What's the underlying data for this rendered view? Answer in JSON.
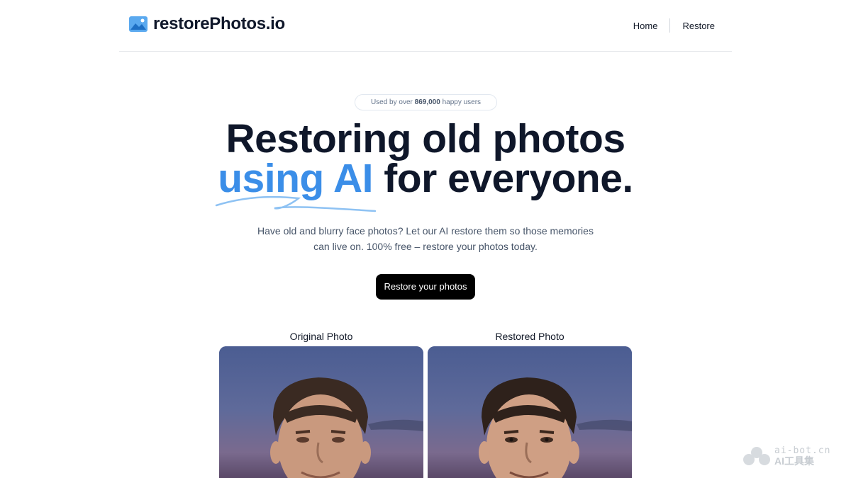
{
  "header": {
    "brand_name": "restorePhotos.io",
    "brand_icon": "photo-icon",
    "nav": [
      {
        "label": "Home"
      },
      {
        "label": "Restore"
      }
    ]
  },
  "hero": {
    "badge_prefix": "Used by over ",
    "badge_count": "869,000",
    "badge_suffix": " happy users",
    "headline_line1": "Restoring old photos",
    "headline_accent": "using AI",
    "headline_rest": " for everyone.",
    "subtitle": "Have old and blurry face photos? Let our AI restore them so those memories can live on. 100% free – restore your photos today.",
    "cta_label": "Restore your photos"
  },
  "comparison": {
    "original_label": "Original Photo",
    "restored_label": "Restored Photo"
  },
  "watermark": {
    "top": "ai-bot.cn",
    "bottom": "AI工具集"
  },
  "colors": {
    "accent": "#3b8ee8",
    "text": "#0f172a",
    "cta_bg": "#000000"
  }
}
